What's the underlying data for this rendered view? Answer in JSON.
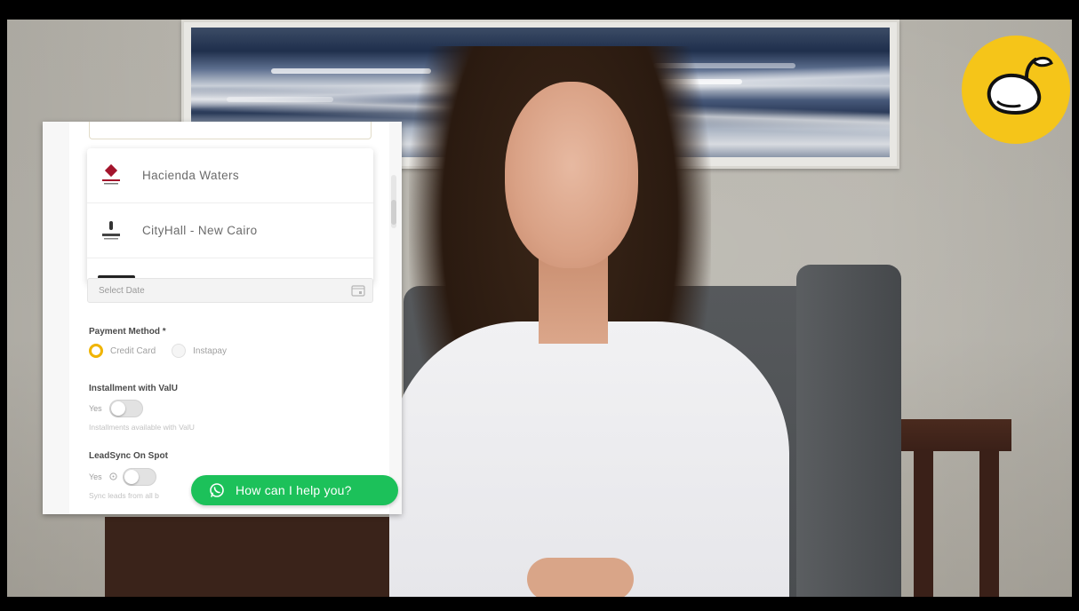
{
  "panel": {
    "dropdown": {
      "items": [
        {
          "label": "Hacienda Waters",
          "logo": "hacienda-waters-logo"
        },
        {
          "label": "CityHall - New Cairo",
          "logo": "cityhall-logo"
        }
      ]
    },
    "date_field": {
      "placeholder": "Select Date",
      "icon": "calendar-icon"
    },
    "payment": {
      "label": "Payment Method *",
      "options": [
        {
          "label": "Credit Card",
          "selected": true
        },
        {
          "label": "Instapay",
          "selected": false
        }
      ]
    },
    "installment": {
      "label": "Installment with ValU",
      "toggle_label": "Yes",
      "helper": "Installments available with ValU"
    },
    "leadsync": {
      "label": "LeadSync On Spot",
      "toggle_label": "Yes",
      "helper": "Sync leads from all b"
    },
    "chat_button": {
      "label": "How can I help you?",
      "icon": "whatsapp-icon"
    }
  },
  "logo_badge": {
    "icon": "mango-icon"
  },
  "colors": {
    "accent_yellow": "#f5c519",
    "radio_selected": "#f0b400",
    "whatsapp_green": "#1cc15a"
  }
}
